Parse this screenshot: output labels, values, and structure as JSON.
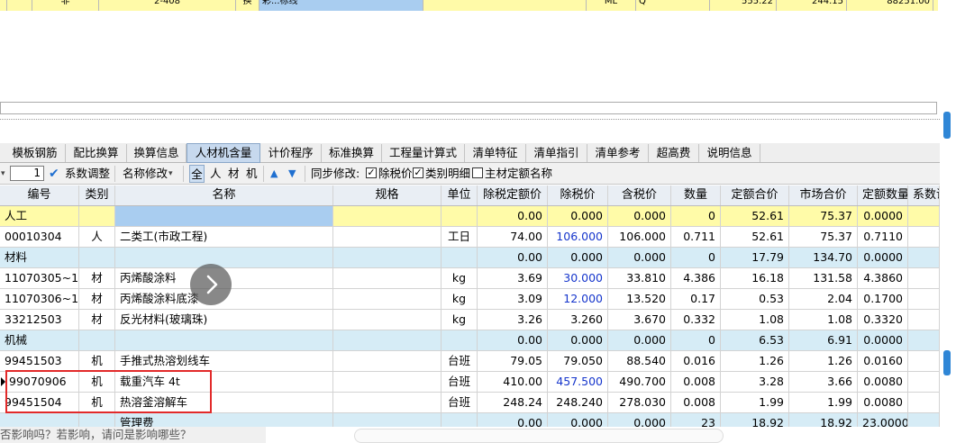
{
  "top_row": {
    "cells": [
      {
        "text": ""
      },
      {
        "text": ""
      },
      {
        "text": "非"
      },
      {
        "text": "2-408"
      },
      {
        "text": "换"
      },
      {
        "text": "彩...标线"
      },
      {
        "text": ""
      },
      {
        "text": "ML"
      },
      {
        "text": "Q"
      },
      {
        "text": "555.22"
      },
      {
        "text": "244.15"
      },
      {
        "text": "88251.00"
      }
    ]
  },
  "tabs": [
    {
      "label": "模板钢筋"
    },
    {
      "label": "配比换算"
    },
    {
      "label": "换算信息"
    },
    {
      "label": "人材机含量"
    },
    {
      "label": "计价程序"
    },
    {
      "label": "标准换算"
    },
    {
      "label": "工程量计算式"
    },
    {
      "label": "清单特征"
    },
    {
      "label": "清单指引"
    },
    {
      "label": "清单参考"
    },
    {
      "label": "超高费"
    },
    {
      "label": "说明信息"
    }
  ],
  "toolbar": {
    "quantity_value": "1",
    "coef_adjust_label": "系数调整",
    "rename_label": "名称修改",
    "filter_all": "全",
    "filter_labor": "人",
    "filter_material": "材",
    "filter_machine": "机",
    "sync_label": "同步修改:",
    "check_tax_label": "除税价",
    "check_category_label": "类别明细",
    "check_main_label": "主材定额名称",
    "check_tax": true,
    "check_category": true,
    "check_main": false
  },
  "table": {
    "headers": [
      "编号",
      "类别",
      "名称",
      "规格",
      "单位",
      "除税定额价",
      "除税价",
      "含税价",
      "数量",
      "定额合价",
      "市场合价",
      "定额数量",
      "系数调"
    ],
    "rows": [
      {
        "type": "group",
        "color": "yellow",
        "cells": [
          "人工",
          "",
          "",
          "",
          "",
          "0.00",
          "0.000",
          "0.000",
          "0",
          "52.61",
          "75.37",
          "0.0000",
          ""
        ]
      },
      {
        "type": "item",
        "cells": [
          "00010304",
          "人",
          "二类工(市政工程)",
          "",
          "工日",
          "74.00",
          "106.000",
          "106.000",
          "0.711",
          "52.61",
          "75.37",
          "0.7110",
          ""
        ],
        "blue_price": true
      },
      {
        "type": "group",
        "color": "blue",
        "cells": [
          "材料",
          "",
          "",
          "",
          "",
          "0.00",
          "0.000",
          "0.000",
          "0",
          "17.79",
          "134.70",
          "0.0000",
          ""
        ]
      },
      {
        "type": "item",
        "cells": [
          "11070305~1",
          "材",
          "丙烯酸涂料",
          "",
          "kg",
          "3.69",
          "30.000",
          "33.810",
          "4.386",
          "16.18",
          "131.58",
          "4.3860",
          ""
        ],
        "blue_price": true
      },
      {
        "type": "item",
        "cells": [
          "11070306~1",
          "材",
          "丙烯酸涂料底漆",
          "",
          "kg",
          "3.09",
          "12.000",
          "13.520",
          "0.17",
          "0.53",
          "2.04",
          "0.1700",
          ""
        ],
        "blue_price": true
      },
      {
        "type": "item",
        "cells": [
          "33212503",
          "材",
          "反光材料(玻璃珠)",
          "",
          "kg",
          "3.26",
          "3.260",
          "3.670",
          "0.332",
          "1.08",
          "1.08",
          "0.3320",
          ""
        ],
        "blue_price": false
      },
      {
        "type": "group",
        "color": "blue",
        "cells": [
          "机械",
          "",
          "",
          "",
          "",
          "0.00",
          "0.000",
          "0.000",
          "0",
          "6.53",
          "6.91",
          "0.0000",
          ""
        ]
      },
      {
        "type": "item",
        "cells": [
          "99451503",
          "机",
          "手推式热溶划线车",
          "",
          "台班",
          "79.05",
          "79.050",
          "88.540",
          "0.016",
          "1.26",
          "1.26",
          "0.0160",
          ""
        ],
        "blue_price": false
      },
      {
        "type": "item",
        "cells": [
          "99070906",
          "机",
          "载重汽车 4t",
          "",
          "台班",
          "410.00",
          "457.500",
          "490.700",
          "0.008",
          "3.28",
          "3.66",
          "0.0080",
          ""
        ],
        "blue_price": true,
        "current": true
      },
      {
        "type": "item",
        "cells": [
          "99451504",
          "机",
          "热溶釜溶解车",
          "",
          "台班",
          "248.24",
          "248.240",
          "278.030",
          "0.008",
          "1.99",
          "1.99",
          "0.0080",
          ""
        ],
        "blue_price": false
      },
      {
        "type": "group",
        "color": "blue",
        "cells": [
          "",
          "",
          "管理费",
          "",
          "",
          "0.00",
          "0.000",
          "0.000",
          "23",
          "18.92",
          "18.92",
          "23.0000",
          ""
        ]
      }
    ]
  },
  "bottom_text": "否影响吗？若影响，请问是影响哪些？",
  "colors": {
    "highlight_border": "#e22a2a",
    "group_yellow": "#fffba8",
    "group_blue": "#d6ecf6",
    "price_blue": "#1636cc",
    "active_tab": "#c7d9ee"
  }
}
